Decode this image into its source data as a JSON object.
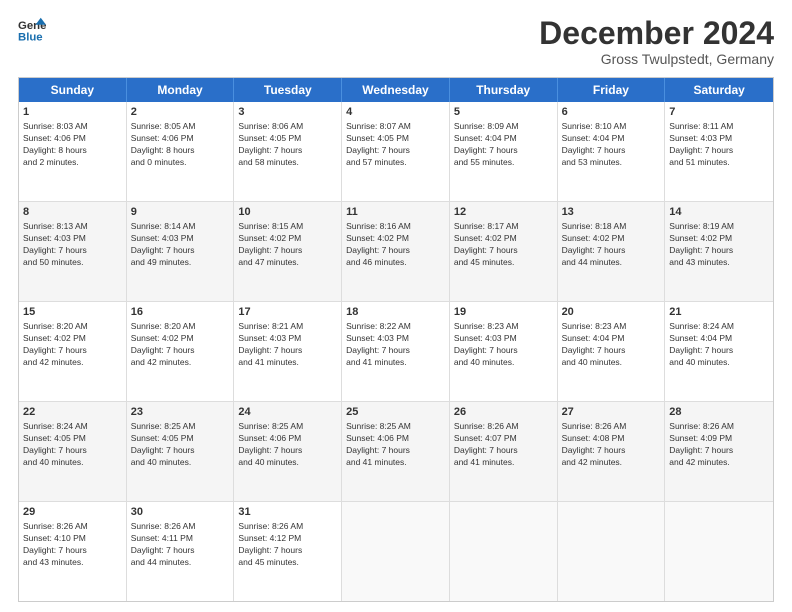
{
  "header": {
    "logo_line1": "General",
    "logo_line2": "Blue",
    "month": "December 2024",
    "location": "Gross Twulpstedt, Germany"
  },
  "days_of_week": [
    "Sunday",
    "Monday",
    "Tuesday",
    "Wednesday",
    "Thursday",
    "Friday",
    "Saturday"
  ],
  "weeks": [
    [
      {
        "day": "1",
        "lines": [
          "Sunrise: 8:03 AM",
          "Sunset: 4:06 PM",
          "Daylight: 8 hours",
          "and 2 minutes."
        ]
      },
      {
        "day": "2",
        "lines": [
          "Sunrise: 8:05 AM",
          "Sunset: 4:06 PM",
          "Daylight: 8 hours",
          "and 0 minutes."
        ]
      },
      {
        "day": "3",
        "lines": [
          "Sunrise: 8:06 AM",
          "Sunset: 4:05 PM",
          "Daylight: 7 hours",
          "and 58 minutes."
        ]
      },
      {
        "day": "4",
        "lines": [
          "Sunrise: 8:07 AM",
          "Sunset: 4:05 PM",
          "Daylight: 7 hours",
          "and 57 minutes."
        ]
      },
      {
        "day": "5",
        "lines": [
          "Sunrise: 8:09 AM",
          "Sunset: 4:04 PM",
          "Daylight: 7 hours",
          "and 55 minutes."
        ]
      },
      {
        "day": "6",
        "lines": [
          "Sunrise: 8:10 AM",
          "Sunset: 4:04 PM",
          "Daylight: 7 hours",
          "and 53 minutes."
        ]
      },
      {
        "day": "7",
        "lines": [
          "Sunrise: 8:11 AM",
          "Sunset: 4:03 PM",
          "Daylight: 7 hours",
          "and 51 minutes."
        ]
      }
    ],
    [
      {
        "day": "8",
        "lines": [
          "Sunrise: 8:13 AM",
          "Sunset: 4:03 PM",
          "Daylight: 7 hours",
          "and 50 minutes."
        ]
      },
      {
        "day": "9",
        "lines": [
          "Sunrise: 8:14 AM",
          "Sunset: 4:03 PM",
          "Daylight: 7 hours",
          "and 49 minutes."
        ]
      },
      {
        "day": "10",
        "lines": [
          "Sunrise: 8:15 AM",
          "Sunset: 4:02 PM",
          "Daylight: 7 hours",
          "and 47 minutes."
        ]
      },
      {
        "day": "11",
        "lines": [
          "Sunrise: 8:16 AM",
          "Sunset: 4:02 PM",
          "Daylight: 7 hours",
          "and 46 minutes."
        ]
      },
      {
        "day": "12",
        "lines": [
          "Sunrise: 8:17 AM",
          "Sunset: 4:02 PM",
          "Daylight: 7 hours",
          "and 45 minutes."
        ]
      },
      {
        "day": "13",
        "lines": [
          "Sunrise: 8:18 AM",
          "Sunset: 4:02 PM",
          "Daylight: 7 hours",
          "and 44 minutes."
        ]
      },
      {
        "day": "14",
        "lines": [
          "Sunrise: 8:19 AM",
          "Sunset: 4:02 PM",
          "Daylight: 7 hours",
          "and 43 minutes."
        ]
      }
    ],
    [
      {
        "day": "15",
        "lines": [
          "Sunrise: 8:20 AM",
          "Sunset: 4:02 PM",
          "Daylight: 7 hours",
          "and 42 minutes."
        ]
      },
      {
        "day": "16",
        "lines": [
          "Sunrise: 8:20 AM",
          "Sunset: 4:02 PM",
          "Daylight: 7 hours",
          "and 42 minutes."
        ]
      },
      {
        "day": "17",
        "lines": [
          "Sunrise: 8:21 AM",
          "Sunset: 4:03 PM",
          "Daylight: 7 hours",
          "and 41 minutes."
        ]
      },
      {
        "day": "18",
        "lines": [
          "Sunrise: 8:22 AM",
          "Sunset: 4:03 PM",
          "Daylight: 7 hours",
          "and 41 minutes."
        ]
      },
      {
        "day": "19",
        "lines": [
          "Sunrise: 8:23 AM",
          "Sunset: 4:03 PM",
          "Daylight: 7 hours",
          "and 40 minutes."
        ]
      },
      {
        "day": "20",
        "lines": [
          "Sunrise: 8:23 AM",
          "Sunset: 4:04 PM",
          "Daylight: 7 hours",
          "and 40 minutes."
        ]
      },
      {
        "day": "21",
        "lines": [
          "Sunrise: 8:24 AM",
          "Sunset: 4:04 PM",
          "Daylight: 7 hours",
          "and 40 minutes."
        ]
      }
    ],
    [
      {
        "day": "22",
        "lines": [
          "Sunrise: 8:24 AM",
          "Sunset: 4:05 PM",
          "Daylight: 7 hours",
          "and 40 minutes."
        ]
      },
      {
        "day": "23",
        "lines": [
          "Sunrise: 8:25 AM",
          "Sunset: 4:05 PM",
          "Daylight: 7 hours",
          "and 40 minutes."
        ]
      },
      {
        "day": "24",
        "lines": [
          "Sunrise: 8:25 AM",
          "Sunset: 4:06 PM",
          "Daylight: 7 hours",
          "and 40 minutes."
        ]
      },
      {
        "day": "25",
        "lines": [
          "Sunrise: 8:25 AM",
          "Sunset: 4:06 PM",
          "Daylight: 7 hours",
          "and 41 minutes."
        ]
      },
      {
        "day": "26",
        "lines": [
          "Sunrise: 8:26 AM",
          "Sunset: 4:07 PM",
          "Daylight: 7 hours",
          "and 41 minutes."
        ]
      },
      {
        "day": "27",
        "lines": [
          "Sunrise: 8:26 AM",
          "Sunset: 4:08 PM",
          "Daylight: 7 hours",
          "and 42 minutes."
        ]
      },
      {
        "day": "28",
        "lines": [
          "Sunrise: 8:26 AM",
          "Sunset: 4:09 PM",
          "Daylight: 7 hours",
          "and 42 minutes."
        ]
      }
    ],
    [
      {
        "day": "29",
        "lines": [
          "Sunrise: 8:26 AM",
          "Sunset: 4:10 PM",
          "Daylight: 7 hours",
          "and 43 minutes."
        ]
      },
      {
        "day": "30",
        "lines": [
          "Sunrise: 8:26 AM",
          "Sunset: 4:11 PM",
          "Daylight: 7 hours",
          "and 44 minutes."
        ]
      },
      {
        "day": "31",
        "lines": [
          "Sunrise: 8:26 AM",
          "Sunset: 4:12 PM",
          "Daylight: 7 hours",
          "and 45 minutes."
        ]
      },
      {
        "day": "",
        "lines": []
      },
      {
        "day": "",
        "lines": []
      },
      {
        "day": "",
        "lines": []
      },
      {
        "day": "",
        "lines": []
      }
    ]
  ]
}
